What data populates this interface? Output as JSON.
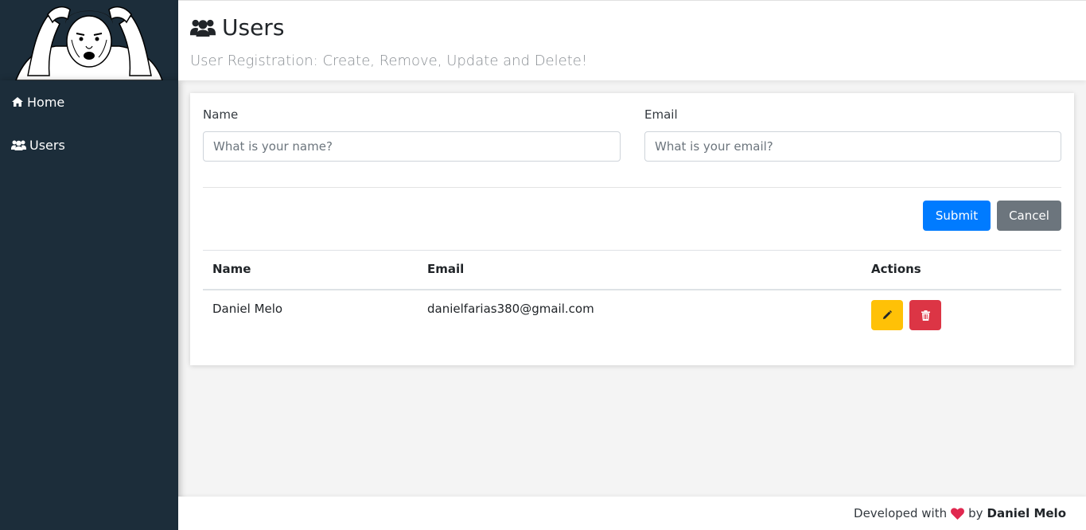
{
  "sidebar": {
    "items": [
      {
        "label": "Home",
        "icon": "home-icon"
      },
      {
        "label": "Users",
        "icon": "users-icon"
      }
    ]
  },
  "header": {
    "title": "Users",
    "subtitle": "User Registration: Create, Remove, Update and Delete!"
  },
  "form": {
    "name_label": "Name",
    "name_placeholder": "What is your name?",
    "name_value": "",
    "email_label": "Email",
    "email_placeholder": "What is your email?",
    "email_value": "",
    "submit_label": "Submit",
    "cancel_label": "Cancel"
  },
  "table": {
    "headers": [
      "Name",
      "Email",
      "Actions"
    ],
    "rows": [
      {
        "name": "Daniel Melo",
        "email": "danielfarias380@gmail.com"
      }
    ]
  },
  "footer": {
    "prefix": "Developed with",
    "middle": "by",
    "author": "Daniel Melo"
  },
  "colors": {
    "sidebar_bg": "#1c2d3a",
    "primary": "#007bff",
    "secondary": "#6c757d",
    "warning": "#ffc107",
    "danger": "#dc3545",
    "heart": "#e0284f"
  }
}
